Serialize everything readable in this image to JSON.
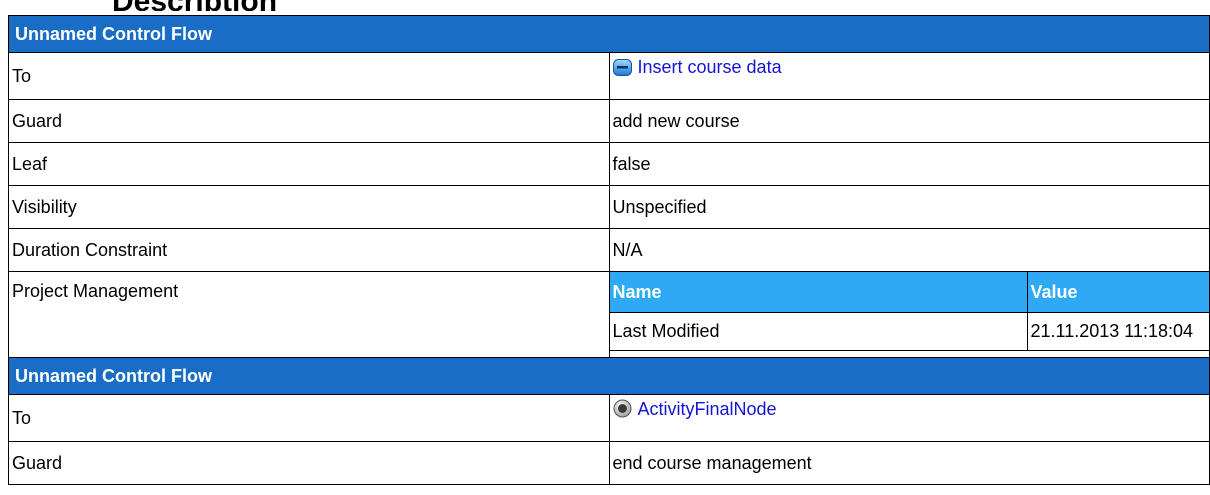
{
  "page": {
    "heading": "Description"
  },
  "sections": [
    {
      "title": "Unnamed Control Flow",
      "to": {
        "label": "To",
        "target": "Insert course data",
        "icon": "action-icon"
      },
      "rows": [
        {
          "name": "Guard",
          "value": "add new course"
        },
        {
          "name": "Leaf",
          "value": "false"
        },
        {
          "name": "Visibility",
          "value": "Unspecified"
        },
        {
          "name": "Duration Constraint",
          "value": "N/A"
        }
      ],
      "project_management": {
        "label": "Project Management",
        "columns": [
          "Name",
          "Value"
        ],
        "rows": [
          {
            "name": "Last Modified",
            "value": "21.11.2013 11:18:04"
          }
        ]
      }
    },
    {
      "title": "Unnamed Control Flow",
      "to": {
        "label": "To",
        "target": "ActivityFinalNode",
        "icon": "final-node-icon"
      },
      "rows": [
        {
          "name": "Guard",
          "value": "end course management"
        }
      ]
    }
  ],
  "colors": {
    "section_header": "#1a6dc4",
    "sub_header": "#2eaaf5",
    "link": "#1414d2"
  }
}
